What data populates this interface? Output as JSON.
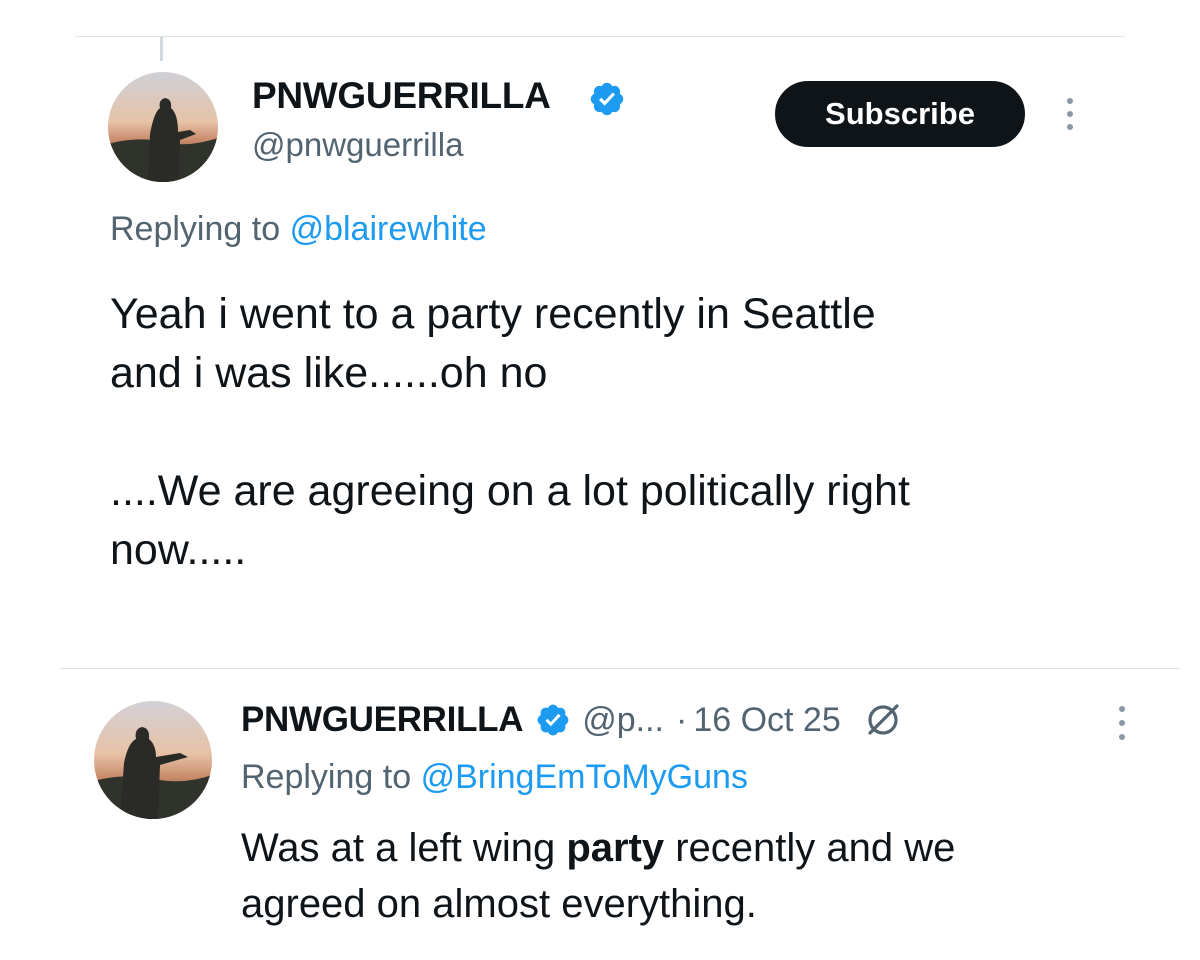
{
  "tweets": [
    {
      "name": "PNWGUERRILLA",
      "handle": "@pnwguerrilla",
      "subscribe_label": "Subscribe",
      "replying_prefix": "Replying to",
      "replying_handle": "@blairewhite",
      "body_lines": [
        "Yeah i went to a party recently in Seattle",
        "and i was like......oh no",
        "",
        "....We are agreeing on a lot politically right",
        "now....."
      ]
    },
    {
      "name": "PNWGUERRILLA",
      "handle": "@p...",
      "separator": "·",
      "date": "16 Oct 25",
      "replying_prefix": "Replying to",
      "replying_handle": "@BringEmToMyGuns",
      "body_line1_before": "Was at a left wing ",
      "body_line1_bold": "party",
      "body_line1_after": " recently and we",
      "body_line2": "agreed on almost everything."
    }
  ],
  "icons": {
    "verified": "verified-badge-icon",
    "more": "more-options-icon",
    "grok": "grok-icon"
  },
  "colors": {
    "accent": "#1d9bf0",
    "text": "#0f1419",
    "secondary": "#536471",
    "divider": "#dfe3e6"
  }
}
